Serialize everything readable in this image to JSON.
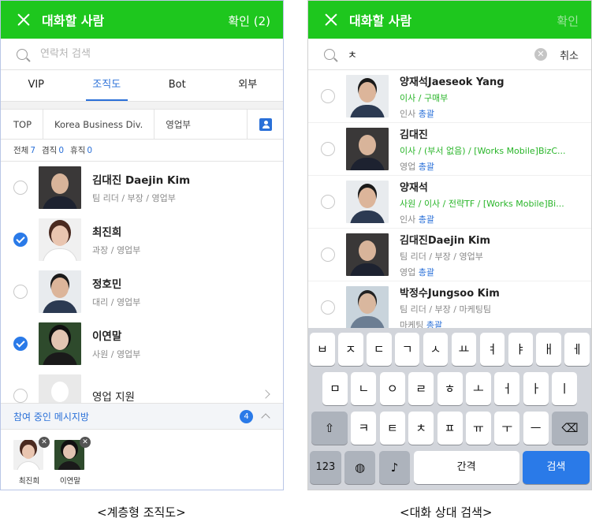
{
  "left": {
    "header": {
      "title": "대화할 사람",
      "confirm": "확인 (2)"
    },
    "search": {
      "placeholder": "연락처 검색"
    },
    "tabs": [
      "VIP",
      "조직도",
      "Bot",
      "외부"
    ],
    "active_tab": "조직도",
    "breadcrumb": [
      "TOP",
      "Korea Business Div.",
      "영업부"
    ],
    "counts": {
      "total_label": "전체",
      "total": "7",
      "concurrent_label": "겸직",
      "concurrent": "0",
      "leave_label": "휴직",
      "leave": "0"
    },
    "members": [
      {
        "name": "김대진 Daejin Kim",
        "sub": "팀 리더 / 부장 / 영업부",
        "checked": false
      },
      {
        "name": "최진희",
        "sub": "과장 / 영업부",
        "checked": true
      },
      {
        "name": "정호민",
        "sub": "대리 / 영업부",
        "checked": false
      },
      {
        "name": "이연말",
        "sub": "사원 / 영업부",
        "checked": true
      },
      {
        "name": "영업 지원",
        "sub": "",
        "checked": false
      }
    ],
    "joined": {
      "label": "참여 중인 메시지방",
      "count": "4"
    },
    "selected": [
      "최진희",
      "이연말"
    ],
    "caption": "<계층형 조직도>"
  },
  "right": {
    "header": {
      "title": "대화할 사람",
      "confirm": "확인"
    },
    "search": {
      "value": "ㅊ",
      "cancel": "취소"
    },
    "results": [
      {
        "name": "양재석Jaeseok Yang",
        "sub": "이사 / 구매부",
        "dept_pre": "인사 ",
        "dept_hl": "총괄"
      },
      {
        "name": "김대진",
        "sub": "이사 / (부서 없음) / [Works Mobile]BizC...",
        "dept_pre": "영업 ",
        "dept_hl": "총괄"
      },
      {
        "name": "양재석",
        "sub": "사원 / 이사 / 전략TF / [Works Mobile]Bi...",
        "dept_pre": "인사 ",
        "dept_hl": "총괄"
      },
      {
        "name": "김대진Daejin Kim",
        "sub": "팀 리더 / 부장 / 영업부",
        "dept_pre": "영업 ",
        "dept_hl": "총괄"
      },
      {
        "name": "박정수Jungsoo Kim",
        "sub": "팀 리더 / 부장 / 마케팅팀",
        "dept_pre": "마케팅 ",
        "dept_hl": "총괄"
      }
    ],
    "keyboard": {
      "row1": [
        "ㅂ",
        "ㅈ",
        "ㄷ",
        "ㄱ",
        "ㅅ",
        "ㅛ",
        "ㅕ",
        "ㅑ",
        "ㅐ",
        "ㅔ"
      ],
      "row2": [
        "ㅁ",
        "ㄴ",
        "ㅇ",
        "ㄹ",
        "ㅎ",
        "ㅗ",
        "ㅓ",
        "ㅏ",
        "ㅣ"
      ],
      "row3": [
        "ㅋ",
        "ㅌ",
        "ㅊ",
        "ㅍ",
        "ㅠ",
        "ㅜ",
        "ㅡ"
      ],
      "numbers": "123",
      "space": "간격",
      "search": "검색"
    },
    "caption": "<대화 상대 검색>"
  }
}
